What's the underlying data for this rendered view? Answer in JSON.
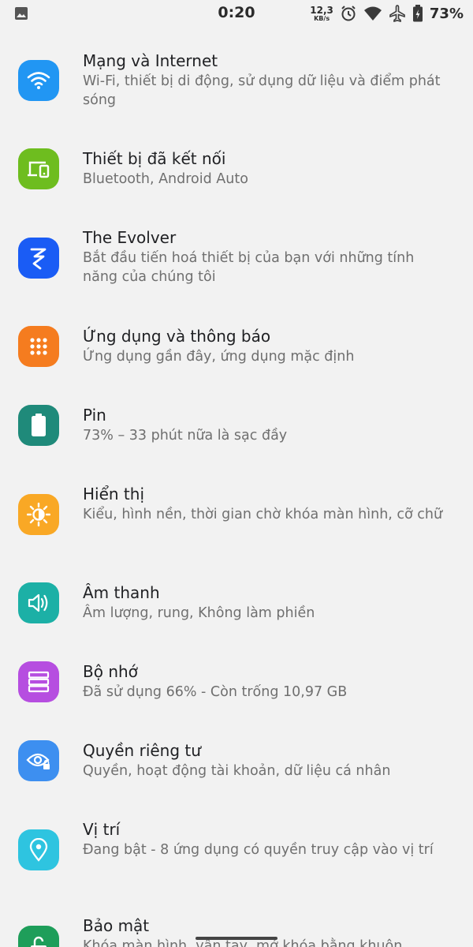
{
  "status_bar": {
    "time": "0:20",
    "net_speed_value": "12,3",
    "net_speed_unit": "KB/s",
    "battery_percent": "73%",
    "icons": [
      "image-icon",
      "alarm-icon",
      "wifi-icon",
      "airplane-icon",
      "battery-icon"
    ]
  },
  "settings": [
    {
      "title": "Mạng và Internet",
      "subtitle": "Wi-Fi, thiết bị di động, sử dụng dữ liệu và điểm phát sóng",
      "icon": "wifi-icon",
      "color": "#2196f3"
    },
    {
      "title": "Thiết bị đã kết nối",
      "subtitle": "Bluetooth, Android Auto",
      "icon": "devices-icon",
      "color": "#6ebd1f"
    },
    {
      "title": "The Evolver",
      "subtitle": "Bắt đầu tiến hoá thiết bị của bạn với những tính năng của chúng tôi",
      "icon": "evolver-icon",
      "color": "#1a5cf5"
    },
    {
      "title": "Ứng dụng và thông báo",
      "subtitle": "Ứng dụng gần đây, ứng dụng mặc định",
      "icon": "apps-grid-icon",
      "color": "#f57c1f"
    },
    {
      "title": "Pin",
      "subtitle": "73% – 33 phút nữa là sạc đầy",
      "icon": "battery-icon",
      "color": "#1f8a7a"
    },
    {
      "title": "Hiển thị",
      "subtitle": "Kiểu, hình nền, thời gian chờ khóa màn hình, cỡ chữ",
      "icon": "brightness-icon",
      "color": "#f9a825"
    },
    {
      "title": "Âm thanh",
      "subtitle": "Âm lượng, rung, Không làm phiền",
      "icon": "volume-icon",
      "color": "#1cb0a6"
    },
    {
      "title": "Bộ nhớ",
      "subtitle": "Đã sử dụng 66% - Còn trống 10,97 GB",
      "icon": "storage-icon",
      "color": "#b64ee0"
    },
    {
      "title": "Quyền riêng tư",
      "subtitle": "Quyền, hoạt động tài khoản, dữ liệu cá nhân",
      "icon": "privacy-eye-icon",
      "color": "#3d8ff0"
    },
    {
      "title": "Vị trí",
      "subtitle": "Đang bật - 8 ứng dụng có quyền truy cập vào vị trí",
      "icon": "location-icon",
      "color": "#2ec4e0"
    },
    {
      "title": "Bảo mật",
      "subtitle": "Khóa màn hình, vân tay, mở khóa bằng khuôn",
      "icon": "lock-icon",
      "color": "#1e9e5a"
    }
  ]
}
